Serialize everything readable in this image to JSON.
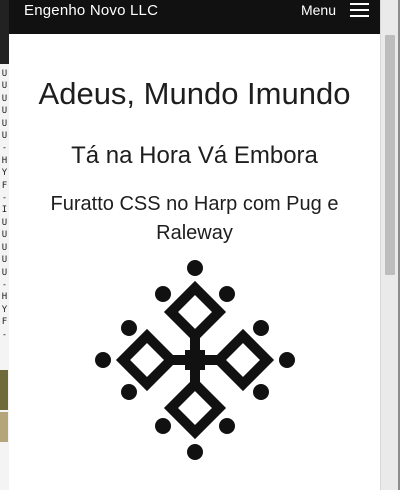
{
  "navbar": {
    "brand": "Engenho Novo LLC",
    "menu_label": "Menu",
    "menu_icon": "hamburger-icon"
  },
  "headings": {
    "title": "Adeus, Mundo Imundo",
    "subtitle": "Tá na Hora Vá Embora",
    "tagline": "Furatto CSS no Harp com Pug e Raleway"
  },
  "emblem": {
    "icon": "occitan-cross-icon",
    "color": "#111111"
  },
  "background_window": {
    "glyphs": [
      "U",
      "U",
      "U",
      "U",
      "U",
      "U",
      "-",
      "H",
      "Y",
      "F",
      "-",
      "I",
      "U",
      "U",
      "U",
      "U",
      "U",
      "-",
      "H",
      "Y",
      "F",
      "-"
    ]
  },
  "colors": {
    "navbar_bg": "#111111",
    "text": "#1e1e1e",
    "page_bg": "#ffffff"
  }
}
